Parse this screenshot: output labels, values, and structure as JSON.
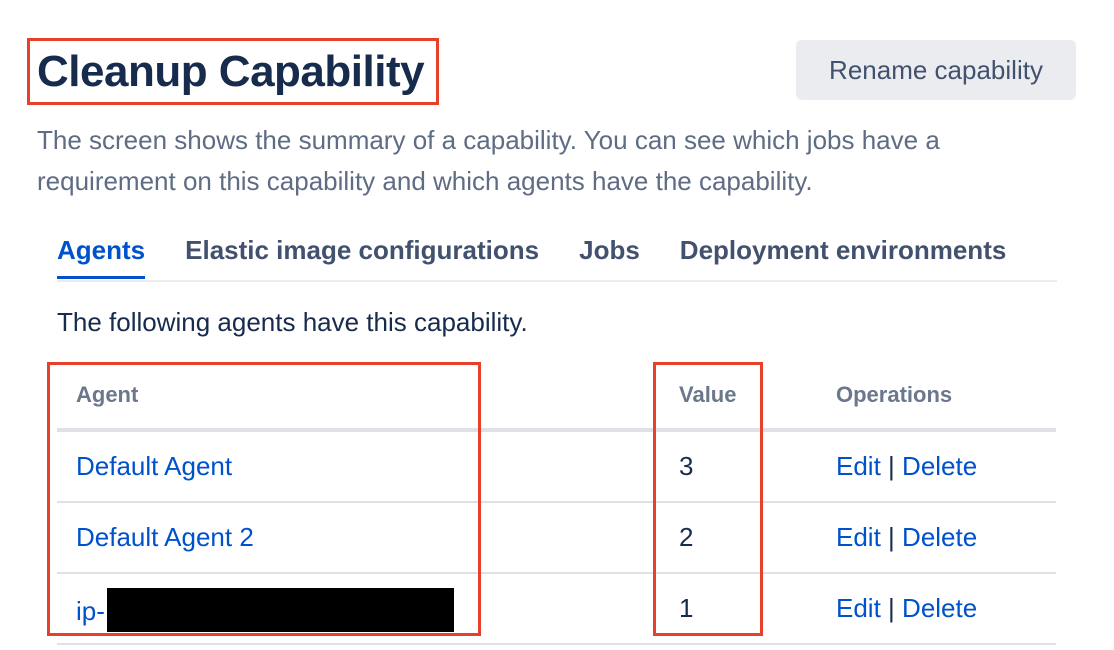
{
  "header": {
    "title": "Cleanup Capability",
    "rename_label": "Rename capability"
  },
  "description": "The screen shows the summary of a capability. You can see which jobs have a requirement on this capability and which agents have the capability.",
  "tabs": [
    {
      "label": "Agents",
      "active": true
    },
    {
      "label": "Elastic image configurations",
      "active": false
    },
    {
      "label": "Jobs",
      "active": false
    },
    {
      "label": "Deployment environments",
      "active": false
    }
  ],
  "agents_section": {
    "intro": "The following agents have this capability.",
    "columns": {
      "agent": "Agent",
      "value": "Value",
      "operations": "Operations"
    },
    "rows": [
      {
        "agent": "Default Agent",
        "value": "3",
        "edit": "Edit",
        "sep": "|",
        "delete": "Delete"
      },
      {
        "agent": "Default Agent 2",
        "value": "2",
        "edit": "Edit",
        "sep": "|",
        "delete": "Delete"
      },
      {
        "agent": "ip-",
        "value": "1",
        "edit": "Edit",
        "sep": "|",
        "delete": "Delete"
      }
    ]
  },
  "colors": {
    "link": "#0052cc",
    "highlight": "#e8412b",
    "title": "#172b4d",
    "redaction": "#000000"
  }
}
